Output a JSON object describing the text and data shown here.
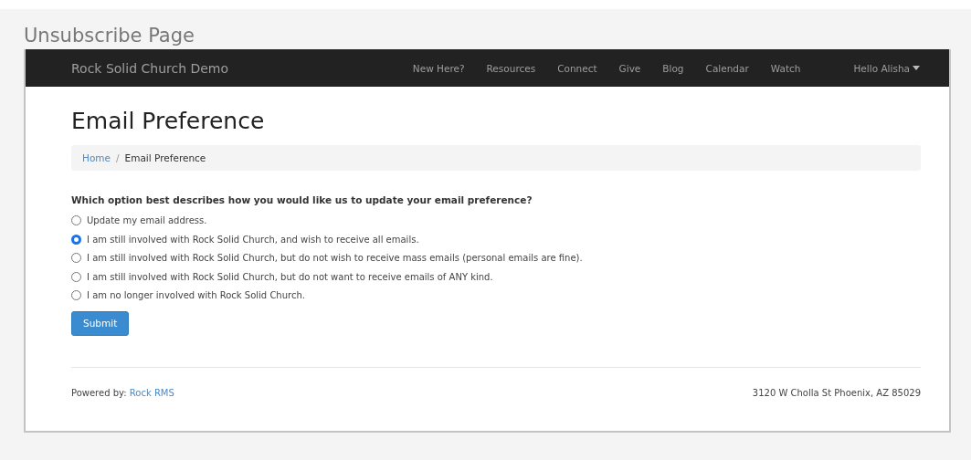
{
  "page_title": "Unsubscribe Page",
  "navbar": {
    "brand": "Rock Solid Church Demo",
    "links": [
      "New Here?",
      "Resources",
      "Connect",
      "Give",
      "Blog",
      "Calendar",
      "Watch"
    ],
    "user_menu": "Hello Alisha"
  },
  "heading": "Email Preference",
  "breadcrumb": [
    {
      "label": "Home",
      "kind": "link"
    },
    {
      "label": "/",
      "kind": "separator"
    },
    {
      "label": "Email Preference",
      "kind": "current"
    }
  ],
  "question": "Which option best describes how you would like us to update your email preference?",
  "options": [
    {
      "label": "Update my email address.",
      "selected": false
    },
    {
      "label": "I am still involved with Rock Solid Church, and wish to receive all emails.",
      "selected": true
    },
    {
      "label": "I am still involved with Rock Solid Church, but do not wish to receive mass emails (personal emails are fine).",
      "selected": false
    },
    {
      "label": "I am still involved with Rock Solid Church, but do not want to receive emails of ANY kind.",
      "selected": false
    },
    {
      "label": "I am no longer involved with Rock Solid Church.",
      "selected": false
    }
  ],
  "submit": "Submit",
  "footer": {
    "powered_by": "Powered by:",
    "powered_link": "Rock RMS",
    "address": "3120 W Cholla St Phoenix, AZ 85029"
  }
}
